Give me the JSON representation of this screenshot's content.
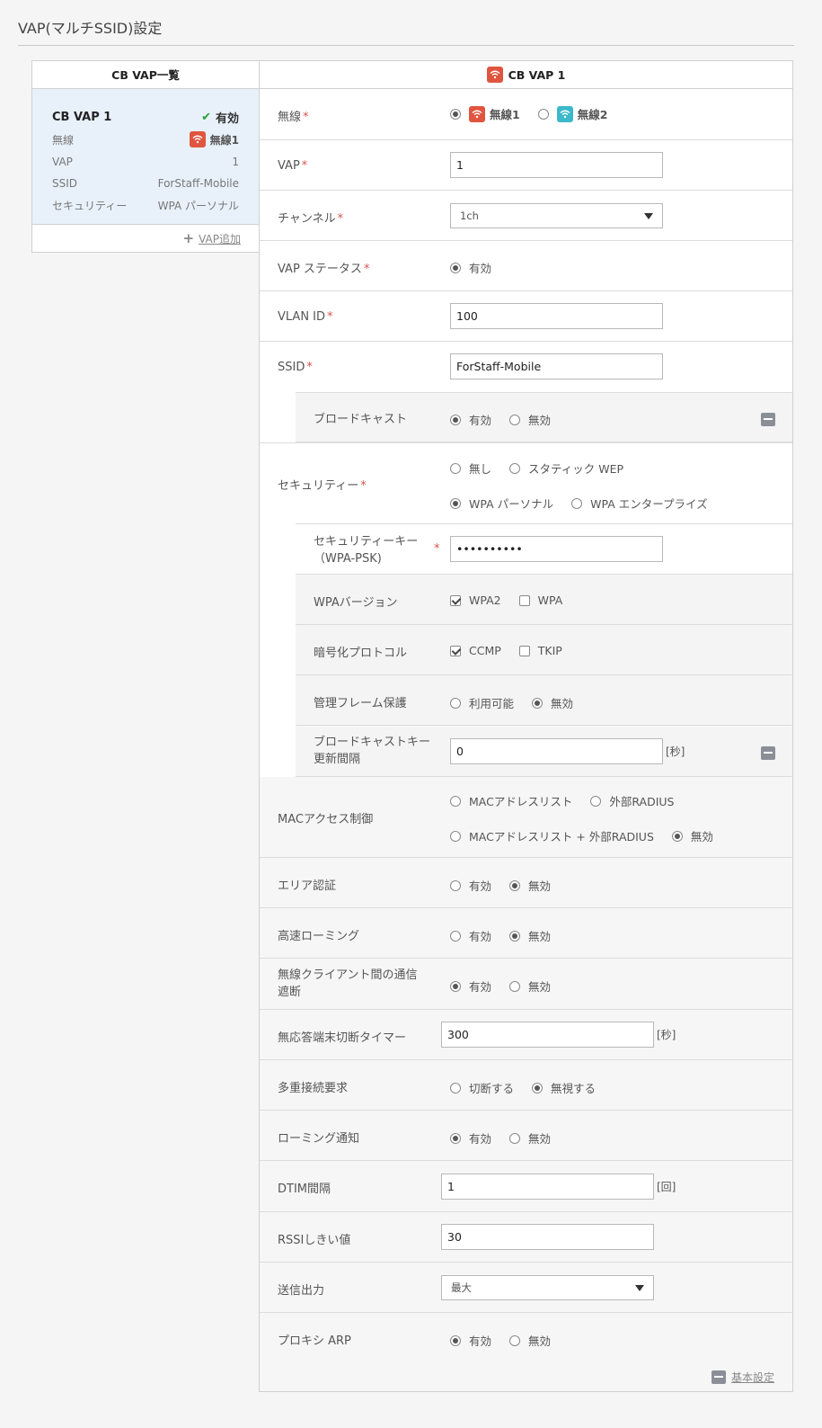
{
  "page": {
    "title": "VAP(マルチSSID)設定"
  },
  "left": {
    "header": "CB VAP一覧",
    "card": {
      "name": "CB VAP 1",
      "status": "有効",
      "rows": [
        {
          "label": "無線",
          "value": "無線1"
        },
        {
          "label": "VAP",
          "value": "1"
        },
        {
          "label": "SSID",
          "value": "ForStaff-Mobile"
        },
        {
          "label": "セキュリティー",
          "value": "WPA パーソナル"
        }
      ]
    },
    "add_label": "VAP追加"
  },
  "right": {
    "header": "CB VAP 1",
    "radio_field": {
      "label": "無線",
      "opt1": "無線1",
      "opt2": "無線2"
    },
    "vap": {
      "label": "VAP",
      "value": "1"
    },
    "channel": {
      "label": "チャンネル",
      "value": "1ch"
    },
    "vap_status": {
      "label": "VAP ステータス",
      "opt1": "有効"
    },
    "vlan": {
      "label": "VLAN ID",
      "value": "100"
    },
    "ssid": {
      "label": "SSID",
      "value": "ForStaff-Mobile"
    },
    "broadcast": {
      "label": "ブロードキャスト",
      "opt1": "有効",
      "opt2": "無効"
    },
    "security": {
      "label": "セキュリティー",
      "opt1": "無し",
      "opt2": "スタティック WEP",
      "opt3": "WPA パーソナル",
      "opt4": "WPA エンタープライズ"
    },
    "seckey": {
      "label1": "セキュリティーキー",
      "label2": "（WPA-PSK)",
      "value": "••••••••••"
    },
    "wpa_version": {
      "label": "WPAバージョン",
      "opt1": "WPA2",
      "opt2": "WPA"
    },
    "cipher": {
      "label": "暗号化プロトコル",
      "opt1": "CCMP",
      "opt2": "TKIP"
    },
    "mgmt_frame": {
      "label": "管理フレーム保護",
      "opt1": "利用可能",
      "opt2": "無効"
    },
    "bcast_key": {
      "label1": "ブロードキャストキー",
      "label2": "更新間隔",
      "value": "0",
      "unit": "[秒]"
    },
    "mac_access": {
      "label": "MACアクセス制御",
      "opt1": "MACアドレスリスト",
      "opt2": "外部RADIUS",
      "opt3": "MACアドレスリスト + 外部RADIUS",
      "opt4": "無効"
    },
    "area_auth": {
      "label": "エリア認証",
      "opt1": "有効",
      "opt2": "無効"
    },
    "fast_roaming": {
      "label": "高速ローミング",
      "opt1": "有効",
      "opt2": "無効"
    },
    "client_isolation": {
      "label1": "無線クライアント間の通信",
      "label2": "遮断",
      "opt1": "有効",
      "opt2": "無効"
    },
    "idle_timer": {
      "label": "無応答端末切断タイマー",
      "value": "300",
      "unit": "[秒]"
    },
    "multi_conn": {
      "label": "多重接続要求",
      "opt1": "切断する",
      "opt2": "無視する"
    },
    "roaming_notify": {
      "label": "ローミング通知",
      "opt1": "有効",
      "opt2": "無効"
    },
    "dtim": {
      "label": "DTIM間隔",
      "value": "1",
      "unit": "[回]"
    },
    "rssi": {
      "label": "RSSIしきい値",
      "value": "30"
    },
    "tx_power": {
      "label": "送信出力",
      "value": "最大"
    },
    "proxy_arp": {
      "label": "プロキシ ARP",
      "opt1": "有効",
      "opt2": "無効"
    },
    "footer_label": "基本設定"
  },
  "colors": {
    "wifi1": "#e0553f",
    "wifi2": "#3bb8c9",
    "required": "#d9534f",
    "ok": "#2a9d3a"
  }
}
